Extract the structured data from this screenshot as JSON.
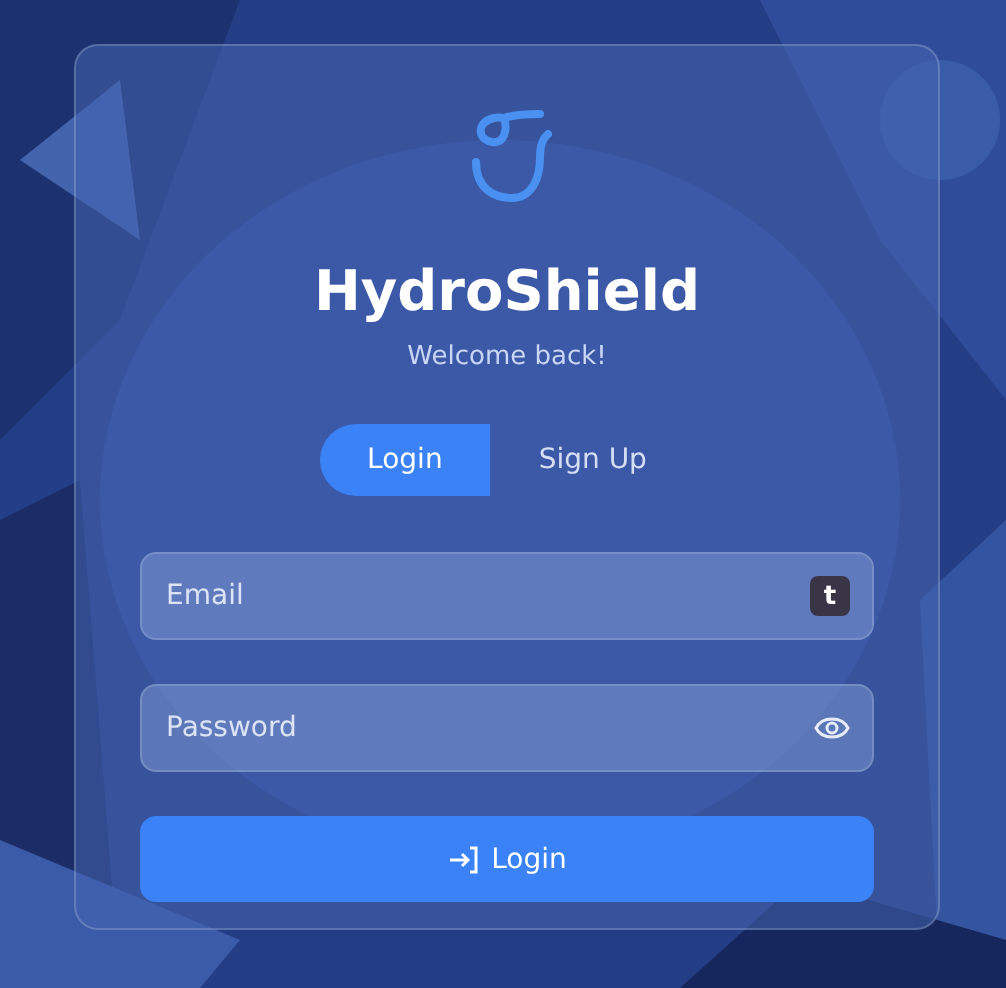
{
  "brand": {
    "title": "HydroShield",
    "subtitle": "Welcome back!"
  },
  "tabs": [
    {
      "label": "Login",
      "selected": true
    },
    {
      "label": "Sign Up",
      "selected": false
    }
  ],
  "fields": [
    {
      "kind": "email",
      "placeholder": "Email",
      "badge": "t"
    },
    {
      "kind": "password",
      "placeholder": "Password"
    }
  ],
  "submit": {
    "label": "Login"
  }
}
